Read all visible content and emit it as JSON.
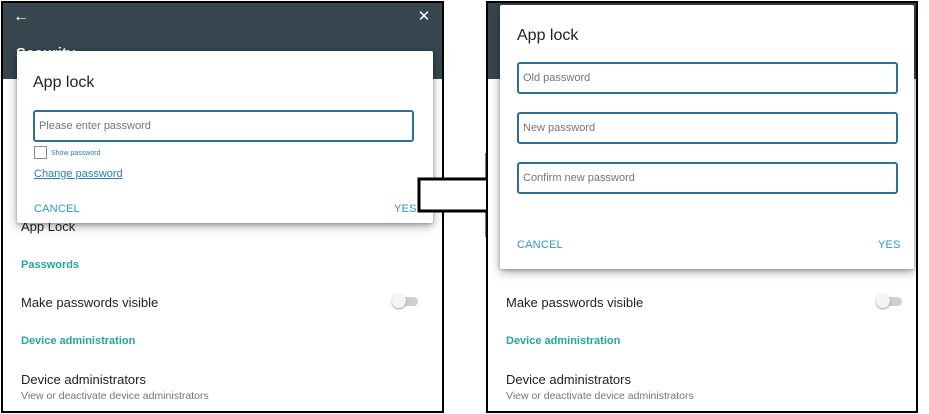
{
  "left": {
    "settings_title": "Security",
    "back_icon": "arrow-back-icon",
    "close_icon": "close-icon",
    "items": {
      "app_lock": "App Lock",
      "passwords_header": "Passwords",
      "make_visible": "Make passwords visible",
      "device_admin_header": "Device administration",
      "device_admins": "Device administrators",
      "device_admins_sub": "View or deactivate device administrators"
    },
    "dialog": {
      "title": "App lock",
      "password_placeholder": "Please enter password",
      "show_password": "Show password",
      "change_password": "Change password",
      "cancel": "CANCEL",
      "yes": "YES"
    }
  },
  "right": {
    "close_icon": "close-icon",
    "items": {
      "make_visible": "Make passwords visible",
      "device_admin_header": "Device administration",
      "device_admins": "Device administrators",
      "device_admins_sub": "View or deactivate device administrators"
    },
    "dialog": {
      "title": "App lock",
      "old_password_placeholder": "Old password",
      "new_password_placeholder": "New password",
      "confirm_password_placeholder": "Confirm new password",
      "cancel": "CANCEL",
      "yes": "YES"
    }
  },
  "colors": {
    "appbar": "#37474f",
    "accent": "#26a69a",
    "input_border": "#2e6f93",
    "button_text": "#2e95c9"
  }
}
